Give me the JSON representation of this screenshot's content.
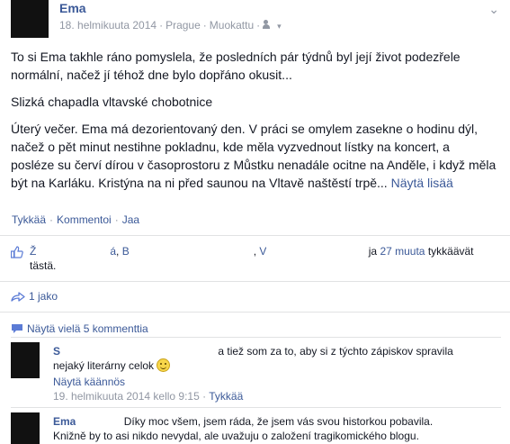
{
  "post": {
    "author": "Ema",
    "date": "18. helmikuuta 2014",
    "location": "Prague",
    "edited": "Muokattu",
    "paragraphs": [
      "To si Ema takhle ráno pomyslela, že posledních pár týdnů byl její život podezřele normální, načež jí téhož dne bylo dopřáno okusit...",
      "Slizká chapadla vltavské chobotnice"
    ],
    "long_paragraph": "Úterý večer. Ema má dezorientovaný den. V práci se omylem zasekne o hodinu dýl, načež o pět minut nestihne pokladnu, kde měla vyzvednout lístky na koncert, a posléze su červí dírou v časoprostoru z Můstku nenadále ocitne na Anděle, i když měla být na Karláku. Kristýna na ni před saunou na Vltavě naštěstí trpě...",
    "see_more": "Näytä lisää"
  },
  "actions": {
    "like": "Tykkää",
    "comment": "Kommentoi",
    "share": "Jaa"
  },
  "likes": {
    "name1": "Ž",
    "name1_end": "á",
    "name2": "B",
    "name3": "V",
    "others": "27 muuta",
    "and": "ja",
    "suffix": "tykkäävät tästä."
  },
  "shares": {
    "label": "1 jako"
  },
  "more_comments": {
    "label": "Näytä vielä 5 kommenttia"
  },
  "comments": [
    {
      "name": "S",
      "text_line1": "a tiež som za to, aby si z týchto zápiskov spravila",
      "text_line2": "nejaký literárny celok",
      "translate": "Näytä käännös",
      "time": "19. helmikuuta 2014 kello 9:15",
      "like": "Tykkää"
    },
    {
      "name": "Ema",
      "text_line1": "Díky moc všem, jsem ráda, že jsem vás svou historkou pobavila.",
      "text_line2": "Knižně by to asi nikdo nevydal, ale uvažuju o založení tragikomického blogu."
    }
  ],
  "colors": {
    "link": "#3b5998",
    "meta": "#9197a3",
    "text": "#141823"
  }
}
